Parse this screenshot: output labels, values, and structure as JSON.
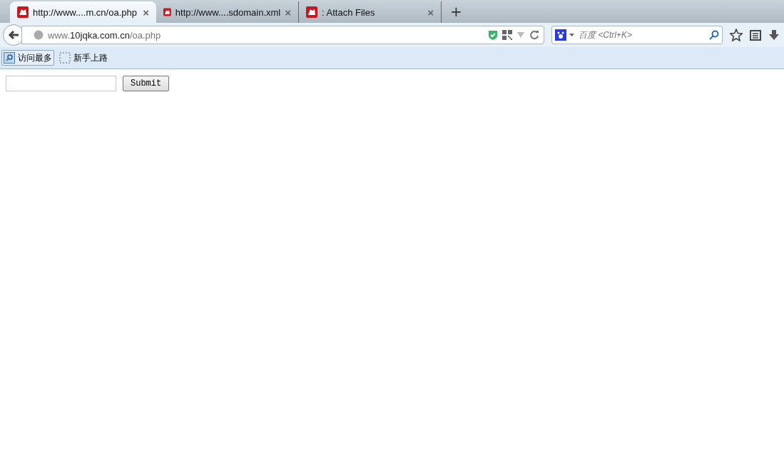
{
  "tabs": [
    {
      "title": "http://www....m.cn/oa.php",
      "selected": true,
      "close": "×"
    },
    {
      "title": "http://www....sdomain.xml",
      "selected": false,
      "close": "×"
    },
    {
      "title": ": Attach Files",
      "selected": false,
      "close": "×"
    }
  ],
  "new_tab": "+",
  "address_bar": {
    "url_prefix": "www.",
    "url_domain": "10jqka.com.cn",
    "url_path": "/oa.php"
  },
  "search": {
    "placeholder": "百度 <Ctrl+K>"
  },
  "bookmarks": [
    {
      "label": "访问最多",
      "hovered": true
    },
    {
      "label": "新手上路",
      "hovered": false
    }
  ],
  "form": {
    "button": "Submit"
  }
}
